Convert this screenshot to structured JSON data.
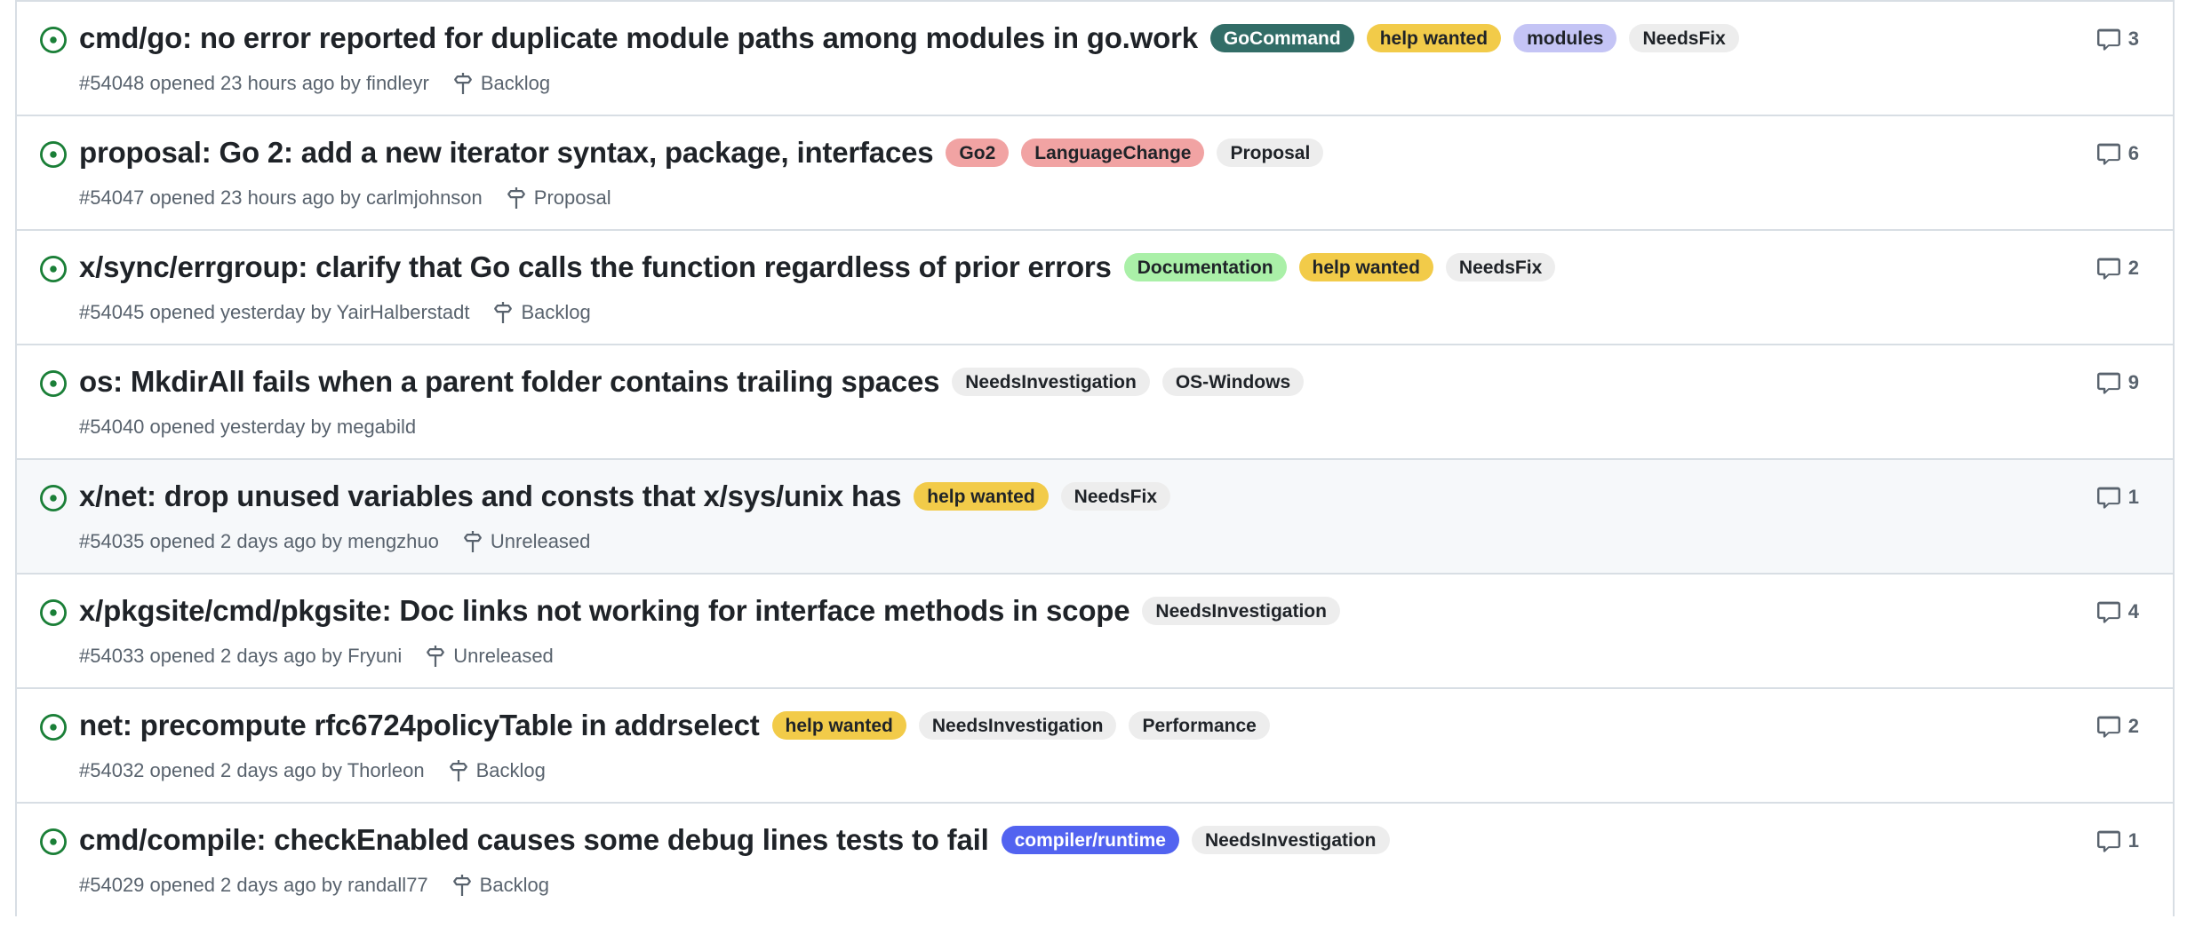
{
  "theme": {
    "border_color": "#d8dee4",
    "row_background": "#ffffff",
    "row_background_highlighted": "#f6f8fa",
    "title_color": "#1f2328",
    "meta_color": "#59636e",
    "open_issue_icon_color": "#1a7f37"
  },
  "icons": {
    "issue_open": "issue-opened-icon",
    "milestone": "milestone-icon",
    "comment": "comment-icon"
  },
  "labels_catalog": {
    "GoCommand": {
      "bg": "#326d67",
      "fg": "#ffffff"
    },
    "help wanted": {
      "bg": "#f2cb49",
      "fg": "#1f2328"
    },
    "modules": {
      "bg": "#c4c4f5",
      "fg": "#1f2328"
    },
    "NeedsFix": {
      "bg": "#ededed",
      "fg": "#1f2328"
    },
    "Go2": {
      "bg": "#f1a3a3",
      "fg": "#1f2328"
    },
    "LanguageChange": {
      "bg": "#f1a3a3",
      "fg": "#1f2328"
    },
    "Proposal": {
      "bg": "#ededed",
      "fg": "#1f2328"
    },
    "Documentation": {
      "bg": "#aaf0a8",
      "fg": "#1f2328"
    },
    "NeedsInvestigation": {
      "bg": "#ededed",
      "fg": "#1f2328"
    },
    "OS-Windows": {
      "bg": "#ededed",
      "fg": "#1f2328"
    },
    "Performance": {
      "bg": "#ededed",
      "fg": "#1f2328"
    },
    "compiler/runtime": {
      "bg": "#5263f0",
      "fg": "#ffffff"
    }
  },
  "issues": [
    {
      "state": "open",
      "title": "cmd/go: no error reported for duplicate module paths among modules in go.work",
      "labels": [
        "GoCommand",
        "help wanted",
        "modules",
        "NeedsFix"
      ],
      "number": "#54048",
      "meta": "#54048 opened 23 hours ago by findleyr",
      "milestone": "Backlog",
      "comments": "3",
      "highlighted": false
    },
    {
      "state": "open",
      "title": "proposal: Go 2: add a new iterator syntax, package, interfaces",
      "labels": [
        "Go2",
        "LanguageChange",
        "Proposal"
      ],
      "number": "#54047",
      "meta": "#54047 opened 23 hours ago by carlmjohnson",
      "milestone": "Proposal",
      "comments": "6",
      "highlighted": false
    },
    {
      "state": "open",
      "title": "x/sync/errgroup: clarify that Go calls the function regardless of prior errors",
      "labels": [
        "Documentation",
        "help wanted",
        "NeedsFix"
      ],
      "number": "#54045",
      "meta": "#54045 opened yesterday by YairHalberstadt",
      "milestone": "Backlog",
      "comments": "2",
      "highlighted": false
    },
    {
      "state": "open",
      "title": "os: MkdirAll fails when a parent folder contains trailing spaces",
      "labels": [
        "NeedsInvestigation",
        "OS-Windows"
      ],
      "number": "#54040",
      "meta": "#54040 opened yesterday by megabild",
      "milestone": "",
      "comments": "9",
      "highlighted": false
    },
    {
      "state": "open",
      "title": "x/net: drop unused variables and consts that x/sys/unix has",
      "labels": [
        "help wanted",
        "NeedsFix"
      ],
      "number": "#54035",
      "meta": "#54035 opened 2 days ago by mengzhuo",
      "milestone": "Unreleased",
      "comments": "1",
      "highlighted": true
    },
    {
      "state": "open",
      "title": "x/pkgsite/cmd/pkgsite: Doc links not working for interface methods in scope",
      "labels": [
        "NeedsInvestigation"
      ],
      "number": "#54033",
      "meta": "#54033 opened 2 days ago by Fryuni",
      "milestone": "Unreleased",
      "comments": "4",
      "highlighted": false
    },
    {
      "state": "open",
      "title": "net: precompute rfc6724policyTable in addrselect",
      "labels": [
        "help wanted",
        "NeedsInvestigation",
        "Performance"
      ],
      "number": "#54032",
      "meta": "#54032 opened 2 days ago by Thorleon",
      "milestone": "Backlog",
      "comments": "2",
      "highlighted": false
    },
    {
      "state": "open",
      "title": "cmd/compile: checkEnabled causes some debug lines tests to fail",
      "labels": [
        "compiler/runtime",
        "NeedsInvestigation"
      ],
      "number": "#54029",
      "meta": "#54029 opened 2 days ago by randall77",
      "milestone": "Backlog",
      "comments": "1",
      "highlighted": false
    }
  ]
}
